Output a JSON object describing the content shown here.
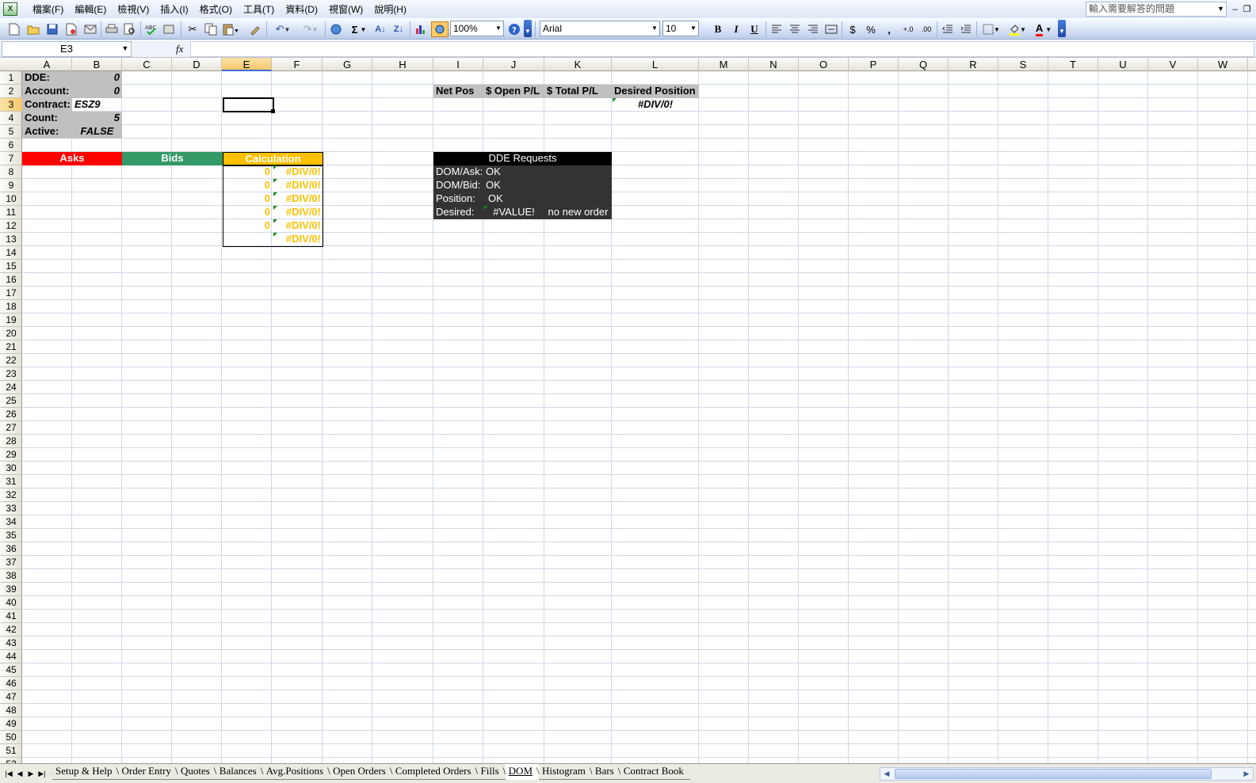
{
  "menu": {
    "items": [
      "檔案(F)",
      "編輯(E)",
      "檢視(V)",
      "插入(I)",
      "格式(O)",
      "工具(T)",
      "資料(D)",
      "視窗(W)",
      "說明(H)"
    ]
  },
  "help_box": {
    "placeholder": "輸入需要解答的問題"
  },
  "toolbar": {
    "zoom": "100%",
    "font_name": "Arial",
    "font_size": "10",
    "bold_label": "B",
    "italic_label": "I",
    "underline_label": "U",
    "currency_label": "$",
    "percent_label": "%",
    "comma_label": ",",
    "sum_label": "Σ",
    "font_color_label": "A",
    "icons": [
      "new-icon",
      "open-icon",
      "save-icon",
      "permission-icon",
      "email-icon",
      "print-icon",
      "print-preview-icon",
      "spelling-icon",
      "research-icon",
      "cut-icon",
      "copy-icon",
      "paste-icon",
      "format-painter-icon",
      "undo-icon",
      "redo-icon",
      "hyperlink-icon",
      "autosum-icon",
      "sort-ascending-icon",
      "sort-descending-icon",
      "chart-wizard-icon",
      "drawing-icon",
      "help-icon"
    ]
  },
  "formula_bar": {
    "name_box": "E3",
    "fx_label": "fx",
    "formula": ""
  },
  "grid": {
    "columns": [
      "A",
      "B",
      "C",
      "D",
      "E",
      "F",
      "G",
      "H",
      "I",
      "J",
      "K",
      "L",
      "M",
      "N",
      "O",
      "P",
      "Q",
      "R",
      "S",
      "T",
      "U",
      "V",
      "W"
    ],
    "rows_visible": 52,
    "active_column": "E",
    "active_row": 3
  },
  "sheet": {
    "info": {
      "dde_label": "DDE:",
      "dde_value": "0",
      "account_label": "Account:",
      "account_value": "0",
      "contract_label": "Contract:",
      "contract_value": "ESZ9",
      "count_label": "Count:",
      "count_value": "5",
      "active_label": "Active:",
      "active_value": "FALSE"
    },
    "headers": {
      "asks": "Asks",
      "bids": "Bids",
      "calculation": "Calculation"
    },
    "calculation_rows": [
      {
        "e": "0",
        "f": "#DIV/0!"
      },
      {
        "e": "0",
        "f": "#DIV/0!"
      },
      {
        "e": "0",
        "f": "#DIV/0!"
      },
      {
        "e": "0",
        "f": "#DIV/0!"
      },
      {
        "e": "0",
        "f": "#DIV/0!"
      },
      {
        "e": "",
        "f": "#DIV/0!"
      }
    ],
    "position": {
      "net_pos": "Net Pos",
      "open_pl": "$ Open P/L",
      "total_pl": "$ Total P/L",
      "desired_position": "Desired Position",
      "desired_value": "#DIV/0!"
    },
    "dde_requests": {
      "title": "DDE Requests",
      "rows": [
        {
          "label": "DOM/Ask:",
          "value": "OK",
          "extra": ""
        },
        {
          "label": "DOM/Bid:",
          "value": "OK",
          "extra": ""
        },
        {
          "label": "Position:",
          "value": "OK",
          "extra": ""
        },
        {
          "label": "Desired:",
          "value": "#VALUE!",
          "extra": "no new order"
        }
      ]
    }
  },
  "sheet_tabs": {
    "tabs": [
      "Setup & Help",
      "Order Entry",
      "Quotes",
      "Balances",
      "Avg.Positions",
      "Open Orders",
      "Completed Orders",
      "Fills",
      "DOM",
      "Histogram",
      "Bars",
      "Contract Book"
    ],
    "active": "DOM"
  },
  "colors": {
    "asks": "#ff0000",
    "bids": "#339966",
    "calculation": "#ffc000",
    "dde_title_bg": "#000000",
    "dde_body_bg": "#333333"
  }
}
